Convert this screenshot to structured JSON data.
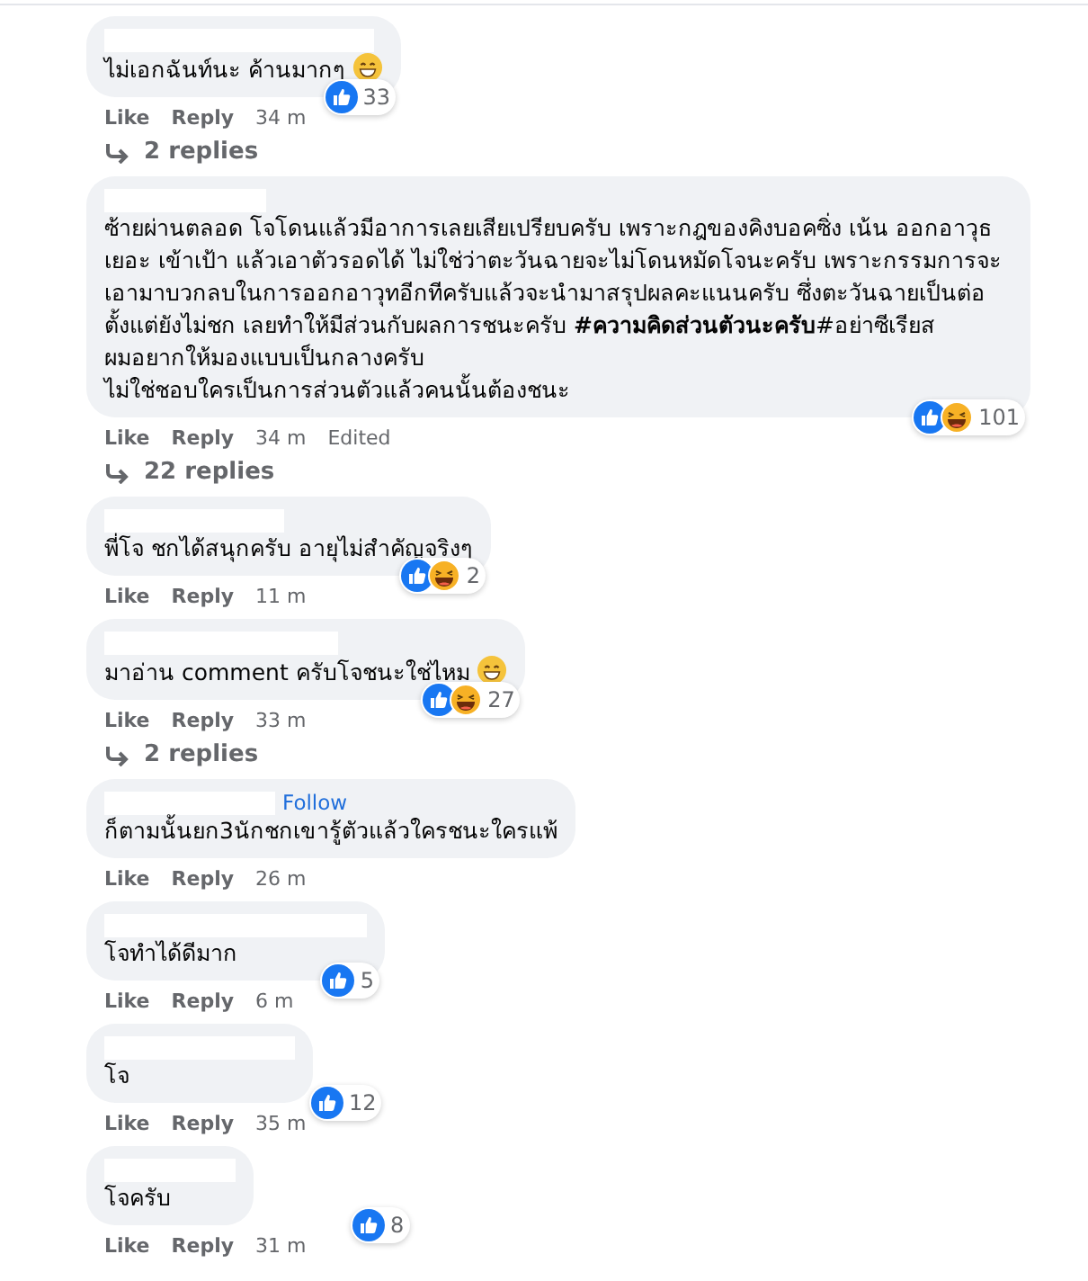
{
  "comments": [
    {
      "text": "ไม่เอกฉันท์นะ ค้านมากๆ",
      "emoji": {
        "kind": "grin"
      },
      "reactions": [
        {
          "kind": "like"
        }
      ],
      "reaction_count": "33",
      "actions": [
        "Like",
        "Reply"
      ],
      "time": "34 m",
      "replies": "2 replies"
    },
    {
      "text": "ซ้ายผ่านตลอด โจโดนแล้วมีอาการเลยเสียเปรียบครับ เพราะกฎของคิงบอคซิ่ง เน้น ออกอาวุธเยอะ เข้าเป้า แล้วเอาตัวรอดได้ ไม่ใช่ว่าตะวันฉายจะไม่โดนหมัดโจนะครับ เพราะกรรมการจะเอามาบวกลบในการออกอาวุทอีกทีครับแล้วจะนำมาสรุปผลคะแนนครับ ซึ่งตะวันฉายเป็นต่อตั้งแต่ยังไม่ชก เลยทำให้มีส่วนกับผลการชนะครับ **#ความคิดส่วนตัวนะครับ**#อย่าซีเรียส\nผมอยากให้มองแบบเป็นกลางครับ\nไม่ใช่ชอบใครเป็นการส่วนตัวแล้วคนนั้นต้องชนะ",
      "reactions": [
        {
          "kind": "like"
        },
        {
          "kind": "haha"
        }
      ],
      "reaction_count": "101",
      "actions": [
        "Like",
        "Reply"
      ],
      "time": "34 m",
      "edited": "Edited",
      "replies": "22 replies"
    },
    {
      "text": "พี่โจ ชกได้สนุกครับ อายุไม่สำคัญจริงๆ",
      "reactions": [
        {
          "kind": "like"
        },
        {
          "kind": "haha"
        }
      ],
      "reaction_count": "2",
      "actions": [
        "Like",
        "Reply"
      ],
      "time": "11 m"
    },
    {
      "text": "มาอ่าน comment ครับโจชนะใช่ไหม",
      "emoji": {
        "kind": "grin"
      },
      "reactions": [
        {
          "kind": "like"
        },
        {
          "kind": "haha"
        }
      ],
      "reaction_count": "27",
      "actions": [
        "Like",
        "Reply"
      ],
      "time": "33 m",
      "replies": "2 replies"
    },
    {
      "follow": "Follow",
      "text": "ก็ตามนั้นยก3นักชกเขารู้ตัวแล้วใครชนะใครแพ้",
      "actions": [
        "Like",
        "Reply"
      ],
      "time": "26 m"
    },
    {
      "text": "โจทำได้ดีมาก",
      "reactions": [
        {
          "kind": "like"
        }
      ],
      "reaction_count": "5",
      "actions": [
        "Like",
        "Reply"
      ],
      "time": "6 m"
    },
    {
      "text": "โจ",
      "reactions": [
        {
          "kind": "like"
        }
      ],
      "reaction_count": "12",
      "actions": [
        "Like",
        "Reply"
      ],
      "time": "35 m"
    },
    {
      "text": "โจครับ",
      "reactions": [
        {
          "kind": "like"
        }
      ],
      "reaction_count": "8",
      "actions": [
        "Like",
        "Reply"
      ],
      "time": "31 m"
    }
  ]
}
